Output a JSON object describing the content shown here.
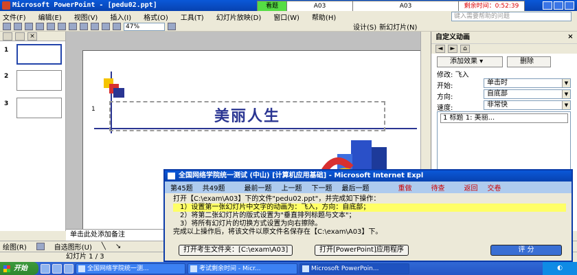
{
  "window": {
    "title": "Microsoft PowerPoint - [pedu02.ppt]"
  },
  "timer": {
    "status": "看题",
    "left_code": "A03",
    "center_code": "A03",
    "remaining": "剩余时间：0:52:39"
  },
  "menu": {
    "items": [
      "文件(F)",
      "编辑(E)",
      "视图(V)",
      "插入(I)",
      "格式(O)",
      "工具(T)",
      "幻灯片放映(D)",
      "窗口(W)",
      "帮助(H)"
    ],
    "ask_placeholder": "键入需要帮助的问题"
  },
  "toolbar": {
    "zoom": "47%",
    "design_label": "设计(S)",
    "new_slide_label": "新幻灯片(N)"
  },
  "left_panel": {
    "slide_numbers": [
      "1",
      "2",
      "3"
    ]
  },
  "slide": {
    "title": "美丽人生",
    "placeholder_number": "1"
  },
  "notes": {
    "placeholder": "单击此处添加备注"
  },
  "drawbar": {
    "draw_label": "绘图(R)",
    "autoshapes_label": "自选图形(U)"
  },
  "status": {
    "slide_count": "幻灯片 1 / 3"
  },
  "taskpane": {
    "title": "自定义动画",
    "add_effect": "添加效果",
    "delete": "删除",
    "modify_label": "修改: 飞入",
    "start_label": "开始:",
    "start_value": "单击时",
    "direction_label": "方向:",
    "direction_value": "自底部",
    "speed_label": "速度:",
    "speed_value": "非常快",
    "anim_item": "1  标题 1: 美丽..."
  },
  "dialog": {
    "title": "全国网络学院统一测试 (中山) [计算机应用基础] - Microsoft Internet Expl",
    "nav": {
      "current": "第45题",
      "total": "共49题",
      "first": "最前一题",
      "prev": "上一题",
      "next": "下一题",
      "last": "最后一题",
      "redo": "重做",
      "pending": "待查",
      "back": "返回",
      "submit": "交卷"
    },
    "lines": [
      "打开【C:\\exam\\A03】下的文件\"pedu02.ppt\"，并完成如下操作：",
      "1）设置第一张幻灯片中文字的动画为：飞入，方向：自底部；",
      "2）将第二张幻灯片的版式设置为\"垂直排列标题与文本\"；",
      "3）将所有幻灯片的切换方式设置为向右擦除。",
      "完成以上操作后，将该文件以原文件名保存在【C:\\exam\\A03】下。"
    ],
    "open_folder": "打开考生文件夹：[C:\\exam\\A03]",
    "open_app": "打开[PowerPoint]应用程序",
    "score": "评  分"
  },
  "taskbar": {
    "start": "开始",
    "tasks": [
      "全国网络学院统一测...",
      "考试剩余时间 - Micr...",
      "Microsoft PowerPoin..."
    ]
  }
}
